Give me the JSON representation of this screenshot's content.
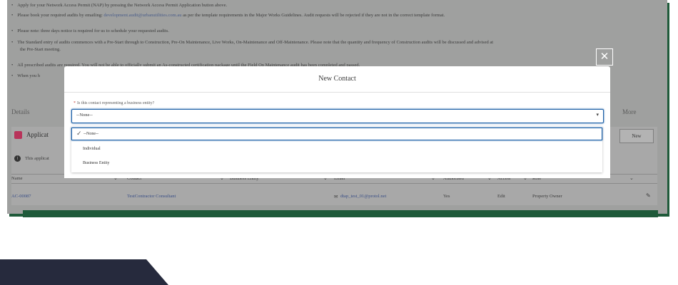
{
  "bullets": [
    {
      "text_before": "Apply for your Network Access Permit (NAP) by pressing the Network Access Permit Application button above."
    },
    {
      "text_before": "Please book your required audits by emailing: ",
      "link": "development.audit@urbanutilities.com.au",
      "text_after": " as per the template requirements in the Major Works Guidelines. Audit requests will be rejected if they are not in the correct template format."
    },
    {
      "text_before": "Please note: three days notice is required for us to schedule your requested audits."
    },
    {
      "text_before": "The Standard entry of audits commences with a Pre-Start through to Construction, Pre-On Maintenance, Live Works, On-Maintenance and Off-Maintenance. Please note that the quantity and frequency of Construction audits will be discussed and advised at"
    },
    {
      "text_before": "the Pre-Start meeting."
    },
    {
      "text_before": "All prescribed audits are required. You will not be able to officially submit an As-constructed certification package until the Field On Maintenance audit has been completed and passed."
    },
    {
      "text_before": "When you h"
    }
  ],
  "tabs": {
    "details": "Details",
    "more": "More"
  },
  "related": {
    "title": "Applicat",
    "new_label": "New",
    "info_text": "This applicat"
  },
  "table": {
    "headers": [
      "Name",
      "Contact",
      "Business Entity",
      "Email",
      "Authorised",
      "Access",
      "Role"
    ],
    "row": {
      "name": "AC-00087",
      "contact": "TestContractor Consultant",
      "email": "dtap_test_01@protol.net",
      "authorised": "Yes",
      "access": "Edit",
      "role": "Property Owner"
    }
  },
  "modal": {
    "title": "New Contact",
    "close_icon": "close-icon",
    "question": "Is this contact representing a business entity?",
    "required_marker": "*",
    "selected_value": "--None--",
    "options": [
      "--None--",
      "Individual",
      "Business Entity"
    ]
  },
  "colors": {
    "overlay": "#9fa09f",
    "accent_blue": "#1b5fa6",
    "footer": "#262a3d",
    "green_shadow": "#1f5a3a"
  }
}
